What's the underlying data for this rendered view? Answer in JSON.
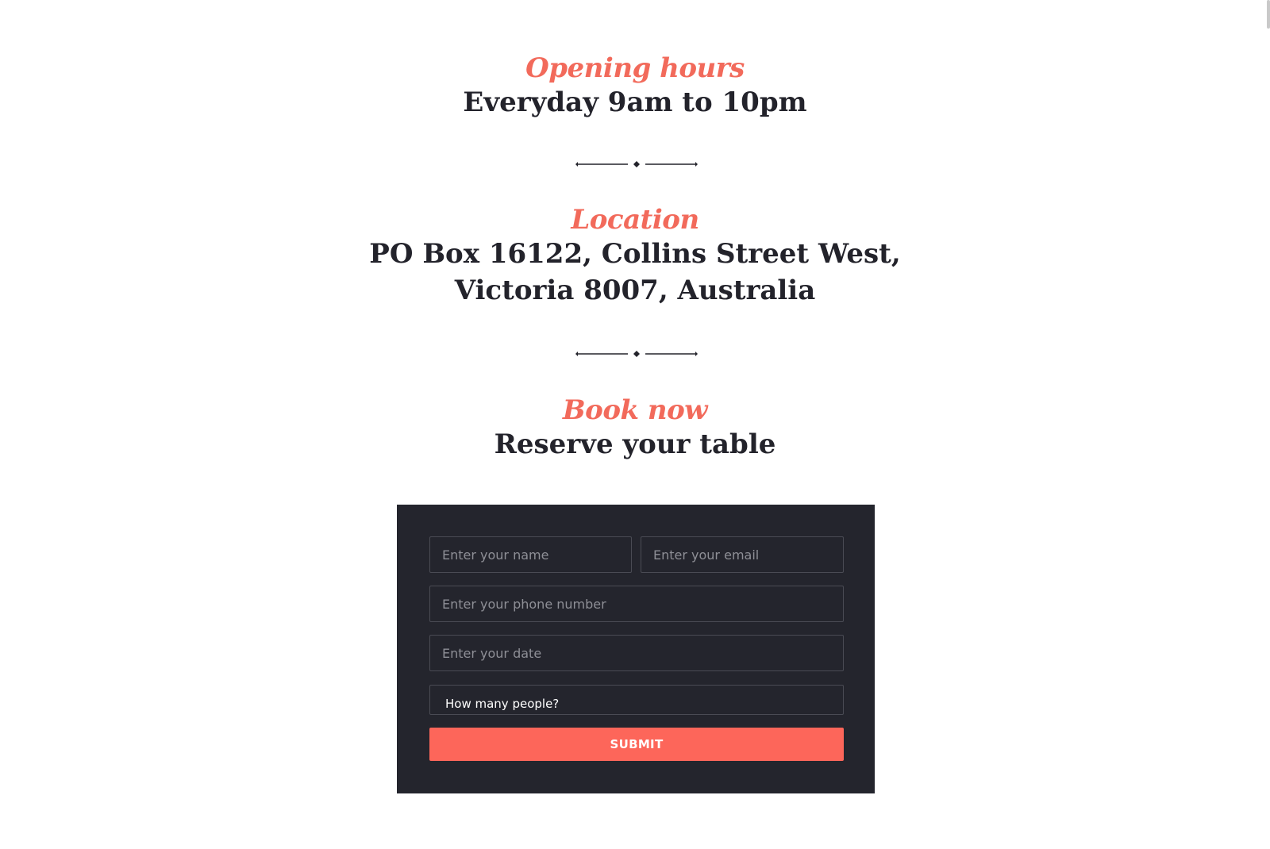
{
  "colors": {
    "accent": "#f26a5b",
    "heading": "#23232b",
    "panel": "#24252d",
    "button": "#fd665a"
  },
  "opening": {
    "script_title": "Opening hours",
    "title": "Everyday 9am to 10pm"
  },
  "location": {
    "script_title": "Location",
    "line1": "PO Box 16122, Collins Street West,",
    "line2": "Victoria 8007, Australia"
  },
  "booking": {
    "script_title": "Book now",
    "title": "Reserve your table"
  },
  "form": {
    "name_placeholder": "Enter your name",
    "email_placeholder": "Enter your email",
    "phone_placeholder": "Enter your phone number",
    "date_placeholder": "Enter your date",
    "people_label": "How many people?",
    "submit_label": "SUBMIT"
  }
}
